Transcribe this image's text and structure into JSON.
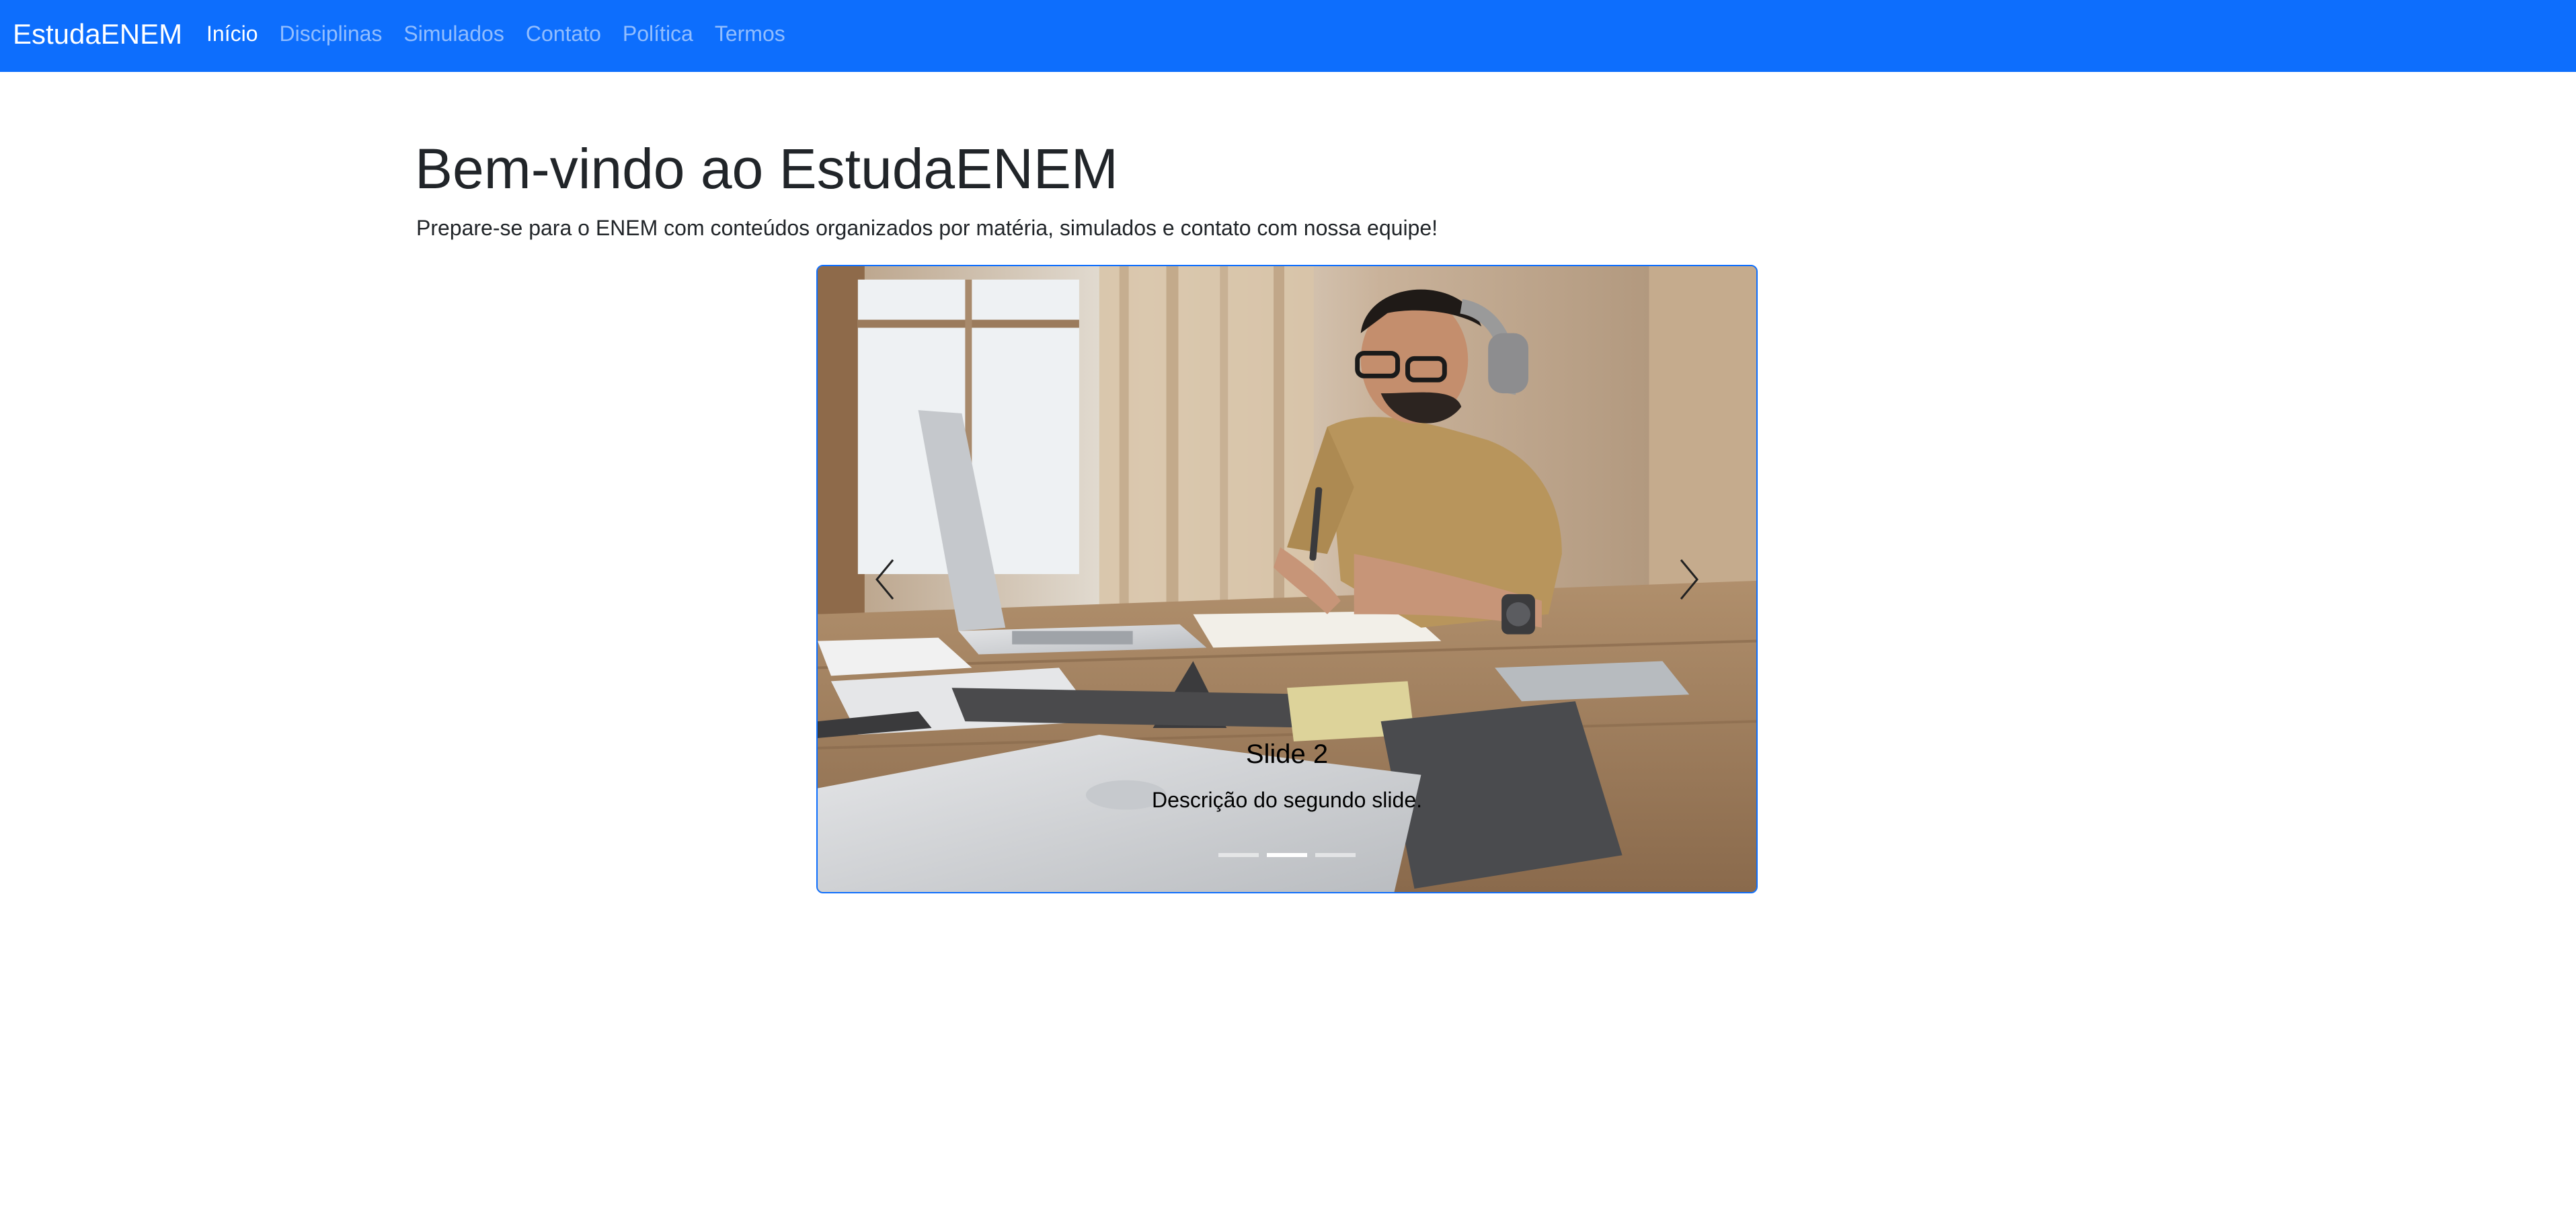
{
  "navbar": {
    "brand": "EstudaENEM",
    "links": [
      {
        "label": "Início",
        "active": true
      },
      {
        "label": "Disciplinas",
        "active": false
      },
      {
        "label": "Simulados",
        "active": false
      },
      {
        "label": "Contato",
        "active": false
      },
      {
        "label": "Política",
        "active": false
      },
      {
        "label": "Termos",
        "active": false
      }
    ],
    "color": "#0d6efd"
  },
  "main": {
    "title": "Bem-vindo ao EstudaENEM",
    "lead": "Prepare-se para o ENEM com conteúdos organizados por matéria, simulados e contato com nossa equipe!"
  },
  "carousel": {
    "caption_title": "Slide 2",
    "caption_text": "Descrição do segundo slide.",
    "slide_count": 3,
    "active_index": 1,
    "prev_icon": "chevron-left-icon",
    "next_icon": "chevron-right-icon",
    "border_color": "#0d6efd"
  }
}
